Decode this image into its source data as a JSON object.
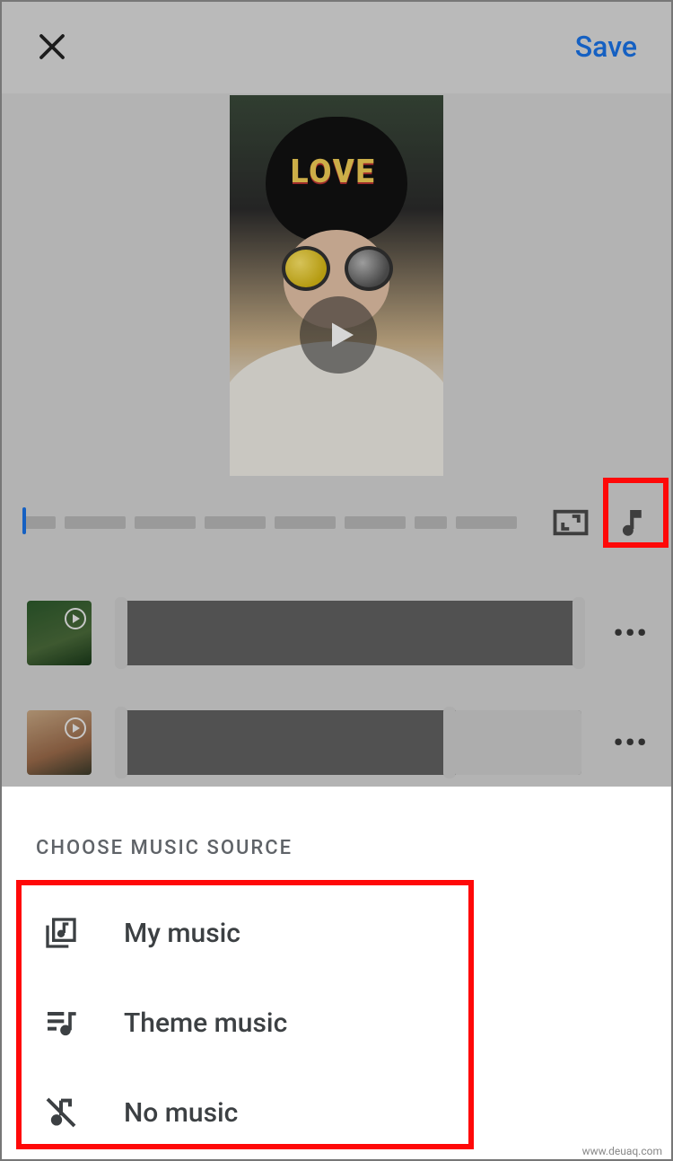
{
  "topbar": {
    "save_label": "Save"
  },
  "preview": {
    "overlay_text": "LOVE"
  },
  "timeline": {
    "segment_widths": [
      36,
      68,
      68,
      68,
      68,
      68,
      36,
      68
    ]
  },
  "clips": [
    {
      "thumb_style": "t1",
      "trim_right_pct": 100
    },
    {
      "thumb_style": "t2",
      "trim_right_pct": 72
    }
  ],
  "sheet": {
    "title": "CHOOSE MUSIC SOURCE",
    "options": [
      {
        "key": "my-music",
        "label": "My music",
        "icon": "library-music-icon"
      },
      {
        "key": "theme-music",
        "label": "Theme music",
        "icon": "queue-music-icon"
      },
      {
        "key": "no-music",
        "label": "No music",
        "icon": "music-off-icon"
      }
    ]
  },
  "watermark": "www.deuaq.com"
}
